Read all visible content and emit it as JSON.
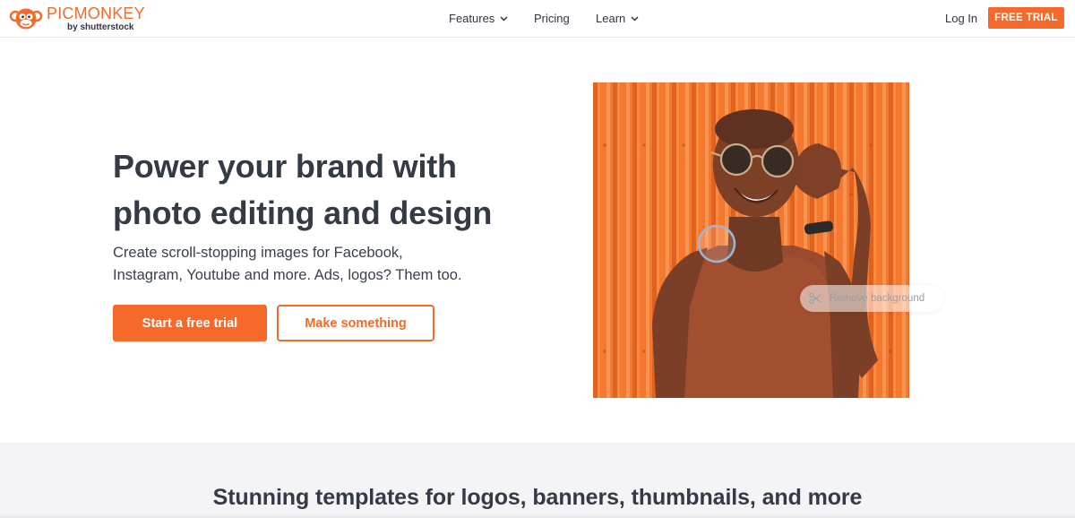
{
  "header": {
    "logo": {
      "wordmark": "PICMONKEY",
      "byline": "by shutterstock"
    },
    "nav": [
      {
        "label": "Features",
        "has_dropdown": true
      },
      {
        "label": "Pricing",
        "has_dropdown": false
      },
      {
        "label": "Learn",
        "has_dropdown": true
      }
    ],
    "login_label": "Log In",
    "free_trial_label": "FREE TRIAL"
  },
  "hero": {
    "title_line1": "Power your brand with",
    "title_line2": "photo editing and design",
    "subtitle_line1": "Create scroll-stopping images for Facebook,",
    "subtitle_line2": "Instagram, Youtube and more. Ads, logos? Them too.",
    "primary_cta": "Start a free trial",
    "secondary_cta": "Make something",
    "image_chip": {
      "label": "Remove background",
      "icon": "scissors-icon"
    }
  },
  "templates_section": {
    "heading": "Stunning templates for logos, banners, thumbnails, and more"
  },
  "colors": {
    "brand_orange": "#f56a2a",
    "text_dark": "#343a46",
    "section_bg": "#f4f4f6"
  }
}
